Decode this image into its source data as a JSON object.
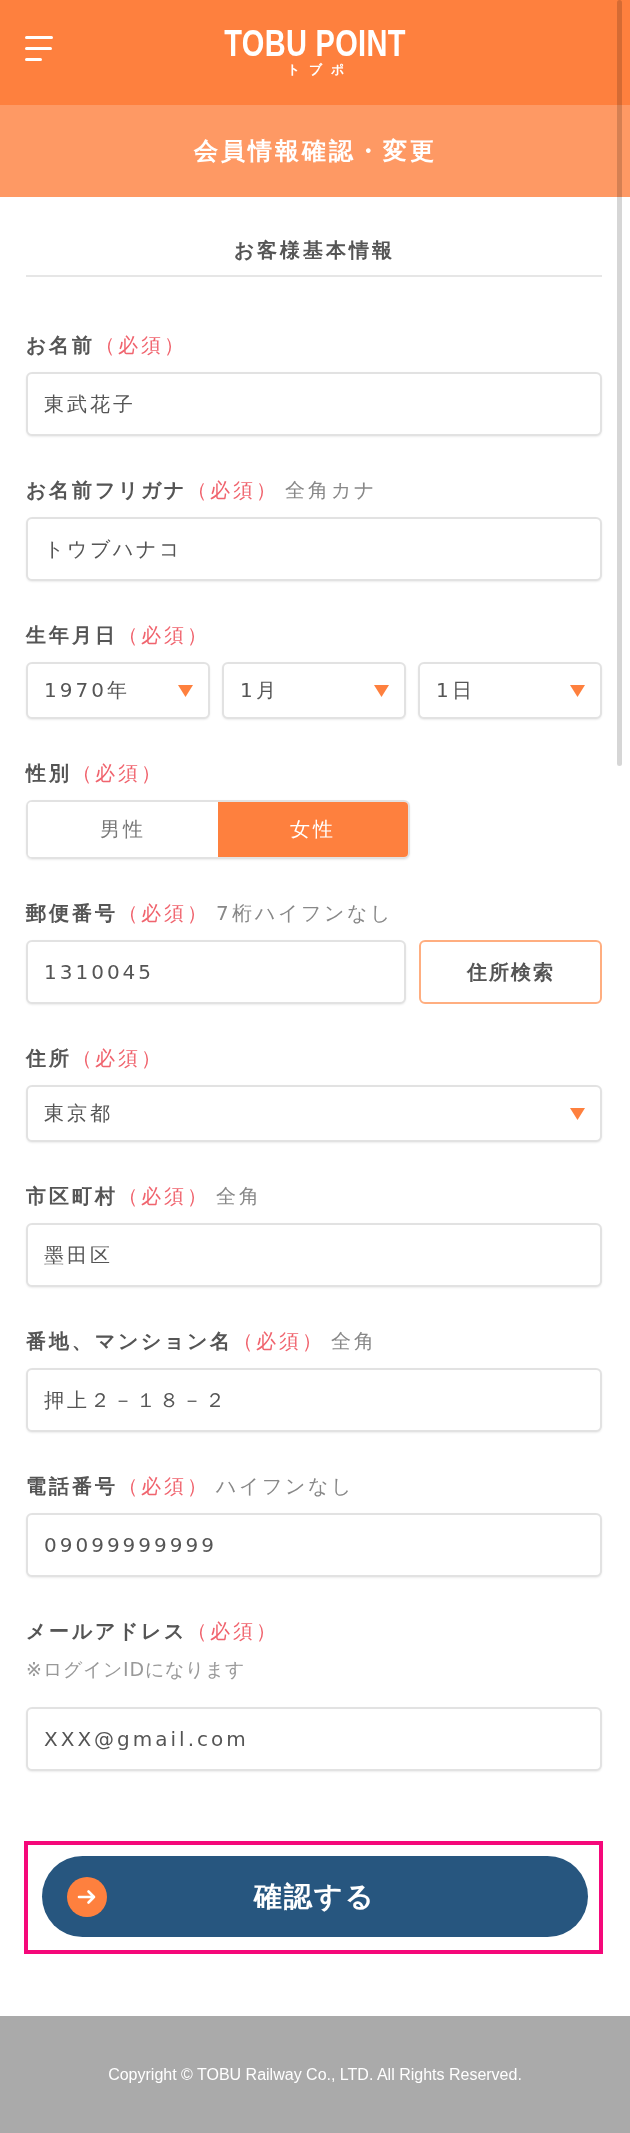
{
  "header": {
    "logo": "TOBU POINT",
    "logo_subtitle": "トブポ"
  },
  "page_title": "会員情報確認・変更",
  "section_title": "お客様基本情報",
  "fields": [
    {
      "kind": "text",
      "label": "お名前",
      "required": "（必須）",
      "value": "東武花子"
    },
    {
      "kind": "text",
      "label": "お名前フリガナ",
      "required": "（必須）",
      "hint": "全角カナ",
      "value": "トウブハナコ"
    },
    {
      "kind": "date",
      "label": "生年月日",
      "required": "（必須）",
      "values": [
        "1970年",
        "1月",
        "1日"
      ]
    },
    {
      "kind": "toggle",
      "label": "性別",
      "required": "（必須）",
      "options": [
        {
          "label": "男性",
          "selected": false
        },
        {
          "label": "女性",
          "selected": true
        }
      ]
    },
    {
      "kind": "lookup",
      "label": "郵便番号",
      "required": "（必須）",
      "hint": "7桁ハイフンなし",
      "value": "1310045",
      "button": "住所検索"
    },
    {
      "kind": "select",
      "label": "住所",
      "required": "（必須）",
      "value": "東京都"
    },
    {
      "kind": "text",
      "label": "市区町村",
      "required": "（必須）",
      "hint": "全角",
      "value": "墨田区"
    },
    {
      "kind": "text",
      "label": "番地、マンション名",
      "required": "（必須）",
      "hint": "全角",
      "value": "押上２－１８－２"
    },
    {
      "kind": "text",
      "label": "電話番号",
      "required": "（必須）",
      "hint": "ハイフンなし",
      "value": "09099999999"
    },
    {
      "kind": "text",
      "label": "メールアドレス",
      "required": "（必須）",
      "note": "※ログインIDになります",
      "value": "XXX@gmail.com"
    }
  ],
  "submit_button": {
    "label": "確認する",
    "highlighted": true
  },
  "footer": {
    "copyright": "Copyright © TOBU Railway Co., LTD. All Rights Reserved."
  }
}
